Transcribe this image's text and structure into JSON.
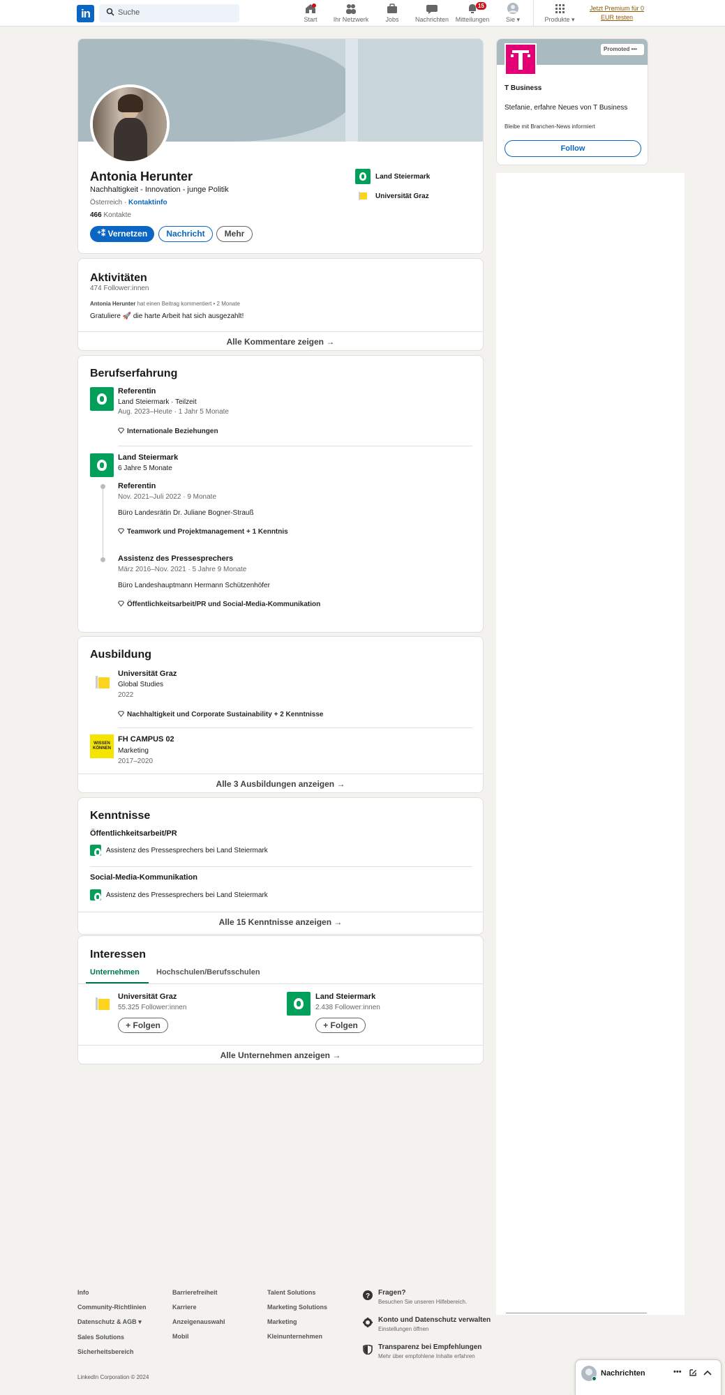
{
  "nav": {
    "search_placeholder": "Suche",
    "items": [
      {
        "label": "Start"
      },
      {
        "label": "Ihr Netzwerk"
      },
      {
        "label": "Jobs"
      },
      {
        "label": "Nachrichten"
      },
      {
        "label": "Mitteilungen",
        "badge": "15"
      },
      {
        "label": "Sie"
      },
      {
        "label": "Produkte"
      }
    ],
    "premium_line1": "Jetzt Premium für 0",
    "premium_line2": "EUR testen",
    "logo_text": "in"
  },
  "profile": {
    "name": "Antonia Herunter",
    "headline": "Nachhaltigkeit - Innovation - junge Politik",
    "location": "Österreich",
    "contact_link": "Kontaktinfo",
    "connections_count": "466",
    "connections_label": "Kontakte",
    "connect_button": "Vernetzen",
    "message_button": "Nachricht",
    "more_button": "Mehr",
    "right_items": [
      {
        "label": "Land Steiermark"
      },
      {
        "label": "Universität Graz"
      }
    ]
  },
  "activity": {
    "title": "Aktivitäten",
    "followers": "474 Follower:innen",
    "meta_author": "Antonia Herunter",
    "meta_text": "hat einen Beitrag kommentiert • 2 Monate",
    "comment": "Gratuliere 🚀 die harte Arbeit hat sich ausgezahlt!",
    "show_all": "Alle Kommentare zeigen →"
  },
  "experience": {
    "title": "Berufserfahrung",
    "first": {
      "role": "Referentin",
      "company": "Land Steiermark · Teilzeit",
      "dates": "Aug. 2023–Heute · 1 Jahr 5 Monate",
      "skills": "Internationale Beziehungen"
    },
    "group": {
      "company": "Land Steiermark",
      "duration": "6 Jahre 5 Monate",
      "roles": [
        {
          "role": "Referentin",
          "dates": "Nov. 2021–Juli 2022 · 9 Monate",
          "desc": "Büro Landesrätin Dr. Juliane Bogner-Strauß",
          "skills": "Teamwork und Projektmanagement + 1 Kenntnis"
        },
        {
          "role": "Assistenz des Pressesprechers",
          "dates": "März 2016–Nov. 2021 · 5 Jahre 9 Monate",
          "desc": "Büro Landeshauptmann Hermann Schützenhöfer",
          "skills": "Öffentlichkeitsarbeit/PR und Social-Media-Kommunikation"
        }
      ]
    }
  },
  "education": {
    "title": "Ausbildung",
    "items": [
      {
        "school": "Universität Graz",
        "degree": "Global Studies",
        "year": "2022",
        "skills": "Nachhaltigkeit und Corporate Sustainability + 2 Kenntnisse"
      },
      {
        "school": "FH CAMPUS 02",
        "degree": "Marketing",
        "year": "2017–2020",
        "logo_text": "WISSEN KÖNNEN"
      }
    ],
    "show_all": "Alle 3 Ausbildungen anzeigen →"
  },
  "skills": {
    "title": "Kenntnisse",
    "items": [
      {
        "name": "Öffentlichkeitsarbeit/PR",
        "context": "Assistenz des Pressesprechers bei Land Steiermark"
      },
      {
        "name": "Social-Media-Kommunikation",
        "context": "Assistenz des Pressesprechers bei Land Steiermark"
      }
    ],
    "show_all": "Alle 15 Kenntnisse anzeigen →"
  },
  "interests": {
    "title": "Interessen",
    "tabs": [
      {
        "label": "Unternehmen"
      },
      {
        "label": "Hochschulen/Berufsschulen"
      }
    ],
    "items": [
      {
        "name": "Universität Graz",
        "followers": "55.325 Follower:innen",
        "button": "Folgen"
      },
      {
        "name": "Land Steiermark",
        "followers": "2.438 Follower:innen",
        "button": "Folgen"
      }
    ],
    "show_all": "Alle Unternehmen anzeigen →"
  },
  "ad": {
    "promoted": "Promoted",
    "company": "T Business",
    "message": "Stefanie, erfahre Neues von T Business",
    "sub": "Bleibe mit Branchen-News informiert",
    "button": "Follow"
  },
  "footer": {
    "col1": [
      "Info",
      "Community-Richtlinien",
      "Datenschutz & AGB",
      "Sales Solutions",
      "Sicherheitsbereich"
    ],
    "col2": [
      "Barrierefreiheit",
      "Karriere",
      "Anzeigenauswahl",
      "Mobil"
    ],
    "col3": [
      "Talent Solutions",
      "Marketing Solutions",
      "Marketing",
      "Kleinunternehmen"
    ],
    "help": [
      {
        "title": "Fragen?",
        "sub": "Besuchen Sie unseren Hilfebereich."
      },
      {
        "title": "Konto und Datenschutz verwalten",
        "sub": "Einstellungen öffnen"
      },
      {
        "title": "Transparenz bei Empfehlungen",
        "sub": "Mehr über empfohlene Inhalte erfahren"
      }
    ],
    "copyright": "LinkedIn Corporation © 2024"
  },
  "messaging": {
    "title": "Nachrichten"
  },
  "colors": {
    "brand": "#0a66c2",
    "land_steiermark": "#00a05a",
    "uni_graz": "#fdd31d",
    "telekom": "#e20074"
  }
}
